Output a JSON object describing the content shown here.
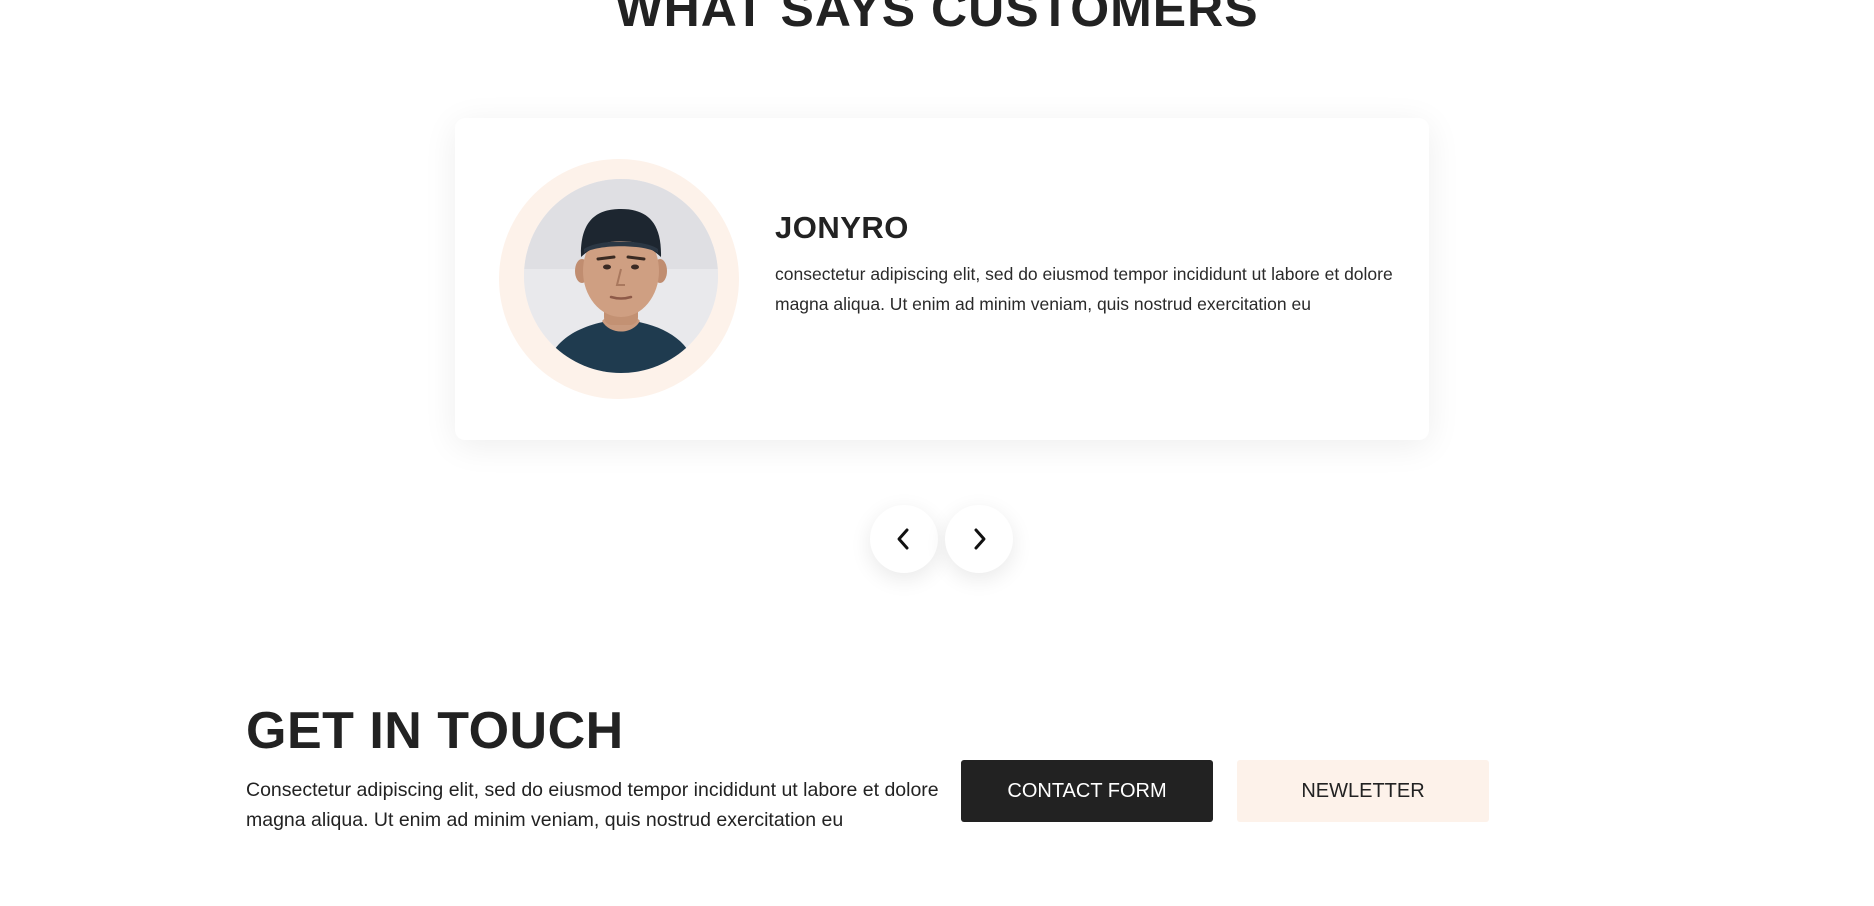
{
  "testimonials": {
    "heading": "WHAT SAYS CUSTOMERS",
    "card": {
      "name": "JONYRO",
      "quote": "consectetur adipiscing elit, sed do eiusmod tempor incididunt ut labore et dolore magna aliqua. Ut enim ad minim veniam, quis nostrud exercitation eu",
      "avatar_icon": "customer-photo"
    },
    "nav": {
      "prev_icon": "chevron-left-icon",
      "next_icon": "chevron-right-icon"
    }
  },
  "contact": {
    "heading": "GET IN TOUCH",
    "text": "Consectetur adipiscing elit, sed do eiusmod tempor incididunt ut labore et dolore magna aliqua. Ut enim ad minim veniam, quis nostrud exercitation eu",
    "contact_form_label": "CONTACT FORM",
    "newsletter_label": "NEWLETTER"
  },
  "colors": {
    "dark": "#222222",
    "accent_light": "#fdf2ea",
    "card_bg": "#ffffff"
  }
}
